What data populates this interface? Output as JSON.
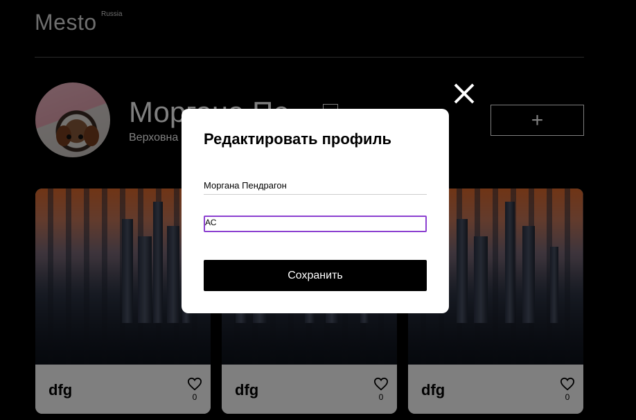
{
  "header": {
    "logo": "Mesto",
    "logo_sup": "Russia"
  },
  "profile": {
    "name": "Моргана Пе",
    "about": "Верховна",
    "add_label": "+"
  },
  "cards": [
    {
      "title": "dfg",
      "likes": "0"
    },
    {
      "title": "dfg",
      "likes": "0"
    },
    {
      "title": "dfg",
      "likes": "0"
    }
  ],
  "modal": {
    "title": "Редактировать профиль",
    "name_value": "Моргана Пендрагон",
    "about_value": "АС",
    "save_label": "Сохранить"
  }
}
